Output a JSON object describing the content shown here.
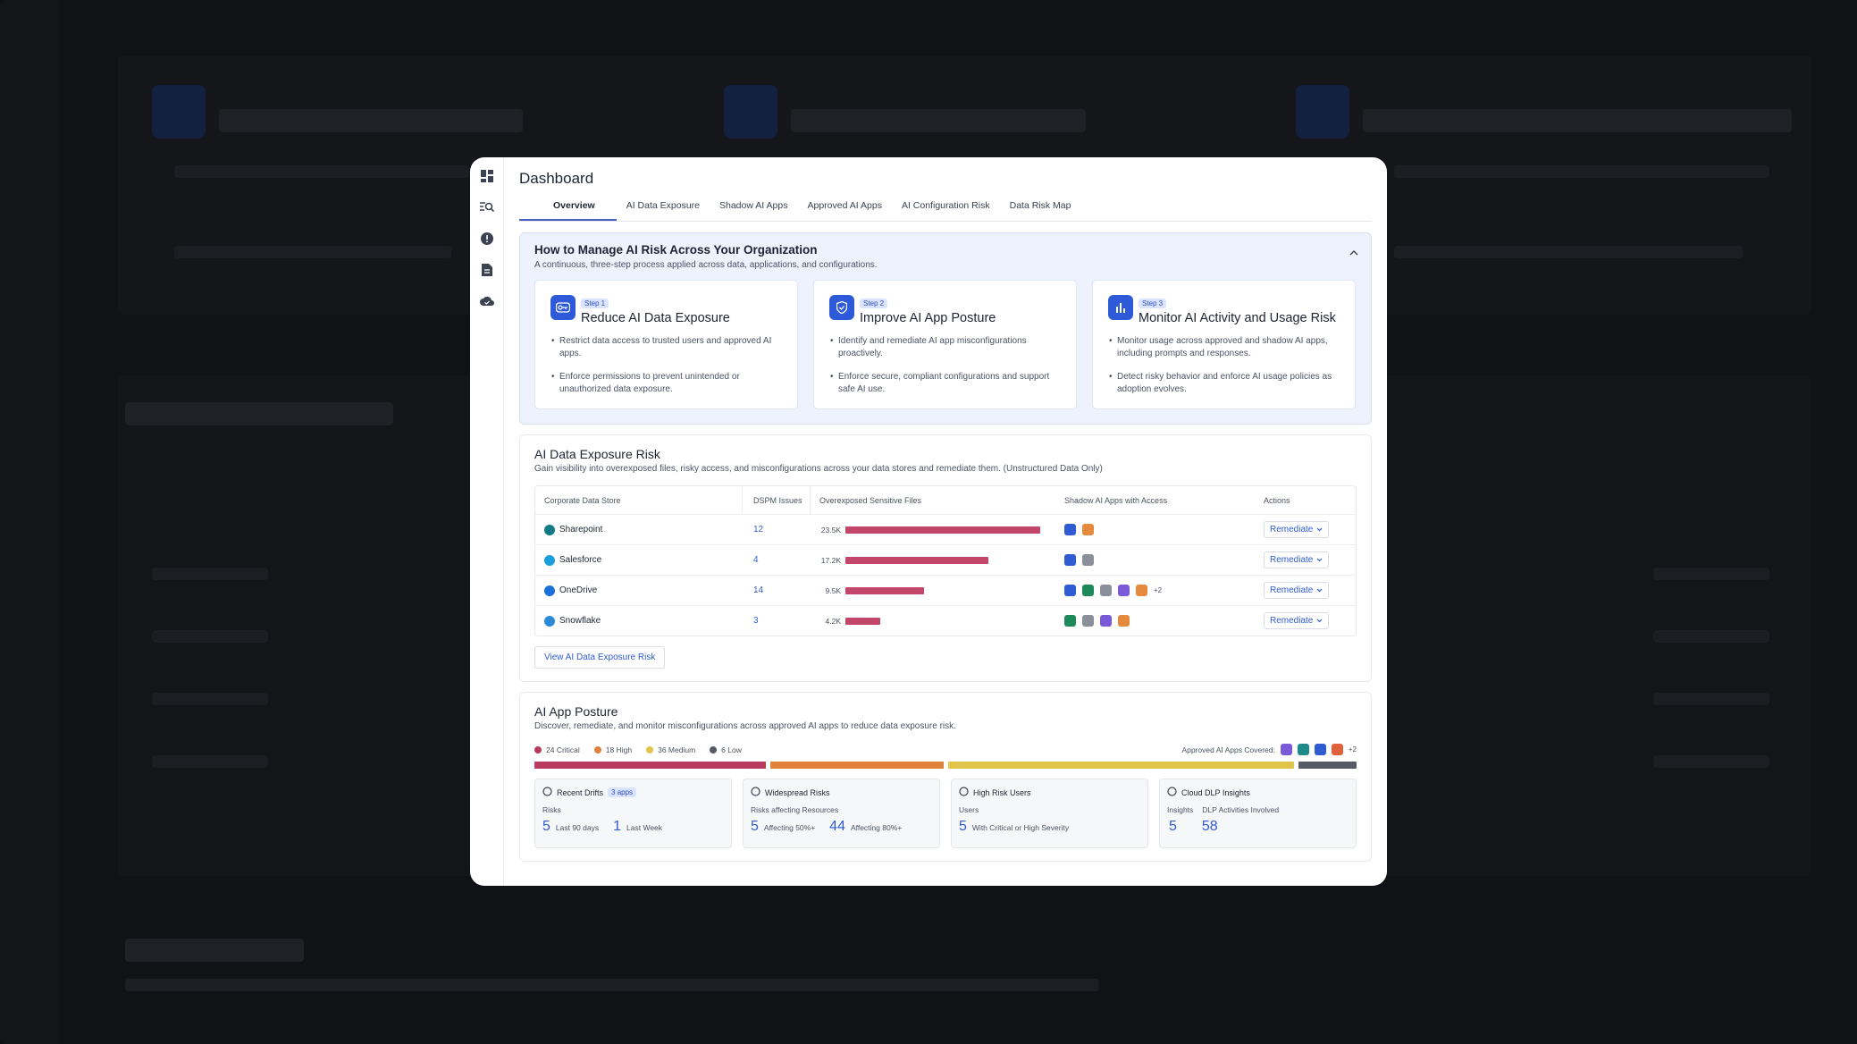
{
  "rail": [
    {
      "name": "dashboard-icon"
    },
    {
      "name": "search-list-icon"
    },
    {
      "name": "alert-icon"
    },
    {
      "name": "document-icon"
    },
    {
      "name": "cloud-icon"
    }
  ],
  "header": {
    "title": "Dashboard"
  },
  "tabs": [
    {
      "label": "Overview",
      "active": true
    },
    {
      "label": "AI Data Exposure"
    },
    {
      "label": "Shadow AI Apps"
    },
    {
      "label": "Approved AI Apps"
    },
    {
      "label": "AI Configuration Risk"
    },
    {
      "label": "Data Risk Map"
    }
  ],
  "guide": {
    "title": "How to Manage AI Risk Across Your Organization",
    "subtitle": "A continuous, three-step process applied across data, applications, and configurations.",
    "steps": [
      {
        "badge": "Step 1",
        "title": "Reduce AI Data Exposure",
        "icon": "key-icon",
        "bullets": [
          "Restrict data access to trusted users and approved AI apps.",
          "Enforce permissions to prevent unintended or unauthorized data exposure."
        ]
      },
      {
        "badge": "Step 2",
        "title": "Improve AI App Posture",
        "icon": "shield-check-icon",
        "bullets": [
          "Identify and remediate AI app misconfigurations proactively.",
          "Enforce secure, compliant configurations and support safe AI use."
        ]
      },
      {
        "badge": "Step 3",
        "title": "Monitor AI Activity and Usage Risk",
        "icon": "bar-chart-icon",
        "bullets": [
          "Monitor usage across approved and shadow AI apps, including prompts and responses.",
          "Detect risky behavior and enforce AI usage policies as adoption evolves."
        ]
      }
    ]
  },
  "exposure": {
    "title": "AI Data Exposure Risk",
    "subtitle": "Gain visibility into overexposed files, risky access, and misconfigurations across your data stores and remediate them. (Unstructured Data Only)",
    "columns": [
      "Corporate Data Store",
      "DSPM Issues",
      "Overexposed Sensitive Files",
      "Shadow AI Apps with Access",
      "Actions"
    ],
    "rows": [
      {
        "store": "Sharepoint",
        "icon": "sharepoint-icon",
        "color": "#0f7b83",
        "issues": "12",
        "files_label": "23.5K",
        "files": 23500,
        "apps": [
          "#2f5bd3",
          "#e58a3c"
        ],
        "extra": ""
      },
      {
        "store": "Salesforce",
        "icon": "salesforce-icon",
        "color": "#1a9fdb",
        "issues": "4",
        "files_label": "17.2K",
        "files": 17200,
        "apps": [
          "#2f5bd3",
          "#8b8f99"
        ],
        "extra": ""
      },
      {
        "store": "OneDrive",
        "icon": "onedrive-icon",
        "color": "#1a6fdb",
        "issues": "14",
        "files_label": "9.5K",
        "files": 9500,
        "apps": [
          "#2f5bd3",
          "#1e8a5a",
          "#8b8f99",
          "#7a5ad8",
          "#e58a3c"
        ],
        "extra": "+2"
      },
      {
        "store": "Snowflake",
        "icon": "snowflake-icon",
        "color": "#2a8bd8",
        "issues": "3",
        "files_label": "4.2K",
        "files": 4200,
        "apps": [
          "#1e8a5a",
          "#8b8f99",
          "#7a5ad8",
          "#e58a3c"
        ],
        "extra": ""
      }
    ],
    "action_label": "Remediate",
    "view_button": "View AI Data Exposure Risk"
  },
  "posture": {
    "title": "AI App Posture",
    "subtitle": "Discover, remediate, and monitor misconfigurations across approved AI apps to reduce data exposure risk.",
    "severity": [
      {
        "label": "24 Critical",
        "count": 24,
        "color": "#b83b5e"
      },
      {
        "label": "18 High",
        "count": 18,
        "color": "#e0813b"
      },
      {
        "label": "36 Medium",
        "count": 36,
        "color": "#e3c44a"
      },
      {
        "label": "6 Low",
        "count": 6,
        "color": "#555a66"
      }
    ],
    "covered_label": "Approved AI Apps Covered:",
    "covered_apps": [
      "#7a5ad8",
      "#1e8a8a",
      "#2f5bd3",
      "#e0613b"
    ],
    "covered_extra": "+2",
    "cards": [
      {
        "title": "Recent Drifts",
        "icon": "warning-icon",
        "tag": "3 apps",
        "sub": "Risks",
        "values": [
          {
            "num": "5",
            "label": "Last 90 days"
          },
          {
            "num": "1",
            "label": "Last Week"
          }
        ]
      },
      {
        "title": "Widespread Risks",
        "icon": "nodes-icon",
        "tag": "",
        "sub": "Risks affecting Resources",
        "values": [
          {
            "num": "5",
            "label": "Affecting 50%+"
          },
          {
            "num": "44",
            "label": "Affecting 80%+"
          }
        ]
      },
      {
        "title": "High Risk Users",
        "icon": "user-icon",
        "tag": "",
        "sub": "Users",
        "values": [
          {
            "num": "5",
            "label": "With Critical or High Severity"
          }
        ]
      },
      {
        "title": "Cloud DLP Insights",
        "icon": "shield-icon",
        "tag": "",
        "sub": "",
        "cols": [
          "Insights",
          "DLP Activities Involved"
        ],
        "values": [
          {
            "num": "5",
            "label": ""
          },
          {
            "num": "58",
            "label": ""
          }
        ]
      }
    ]
  }
}
